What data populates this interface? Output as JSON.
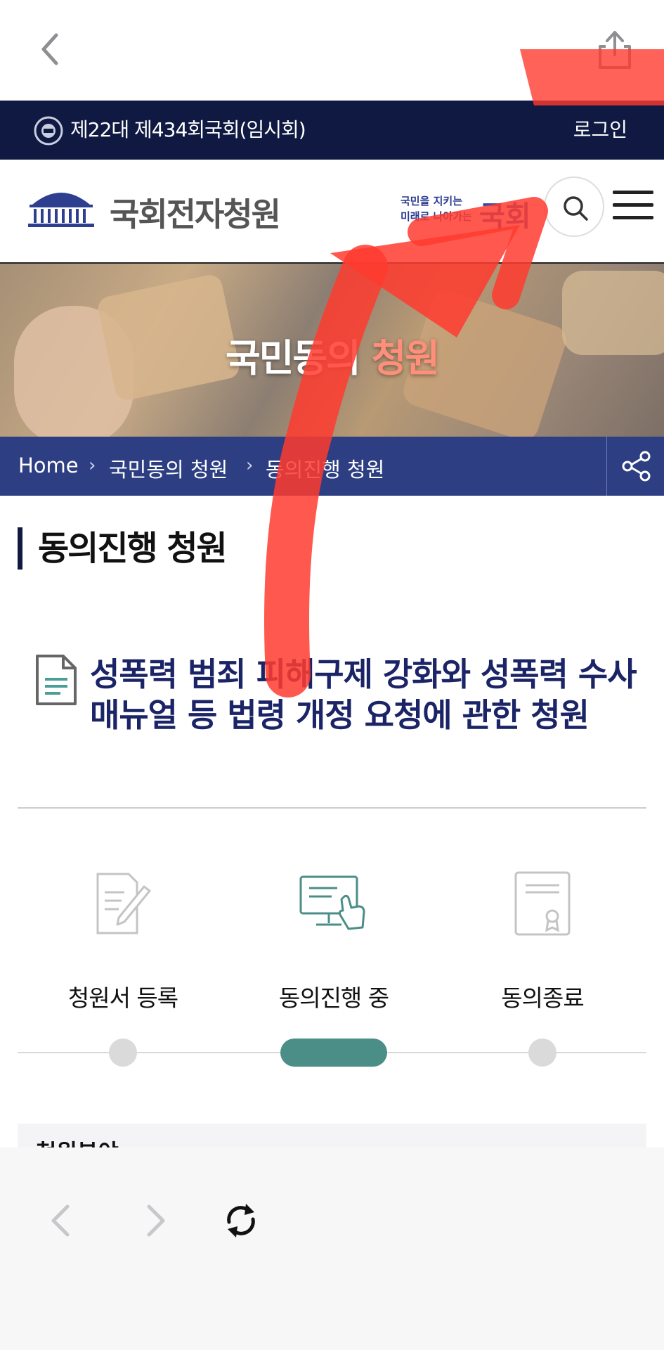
{
  "browser": {
    "back_icon": "chevron-left-icon",
    "share_icon": "share-icon"
  },
  "session_bar": {
    "session_text": "제22대 제434회국회(임시회)",
    "login_label": "로그인"
  },
  "header": {
    "site_name": "국회전자청원",
    "slogan_line1": "국민을 지키는",
    "slogan_line2": "미래로 나아가는",
    "slogan_big": "국회"
  },
  "banner": {
    "title_main": "국민동의 ",
    "title_accent": "청원"
  },
  "breadcrumb": {
    "items": [
      "Home",
      "국민동의 청원",
      "동의진행 청원"
    ]
  },
  "page": {
    "heading": "동의진행 청원",
    "petition_title": "성폭력 범죄 피해구제 강화와 성폭력 수사 매뉴얼 등 법령 개정 요청에 관한 청원"
  },
  "steps": [
    {
      "label": "청원서 등록"
    },
    {
      "label": "동의진행 중"
    },
    {
      "label": "동의종료"
    }
  ],
  "section": {
    "label": "청원분야"
  },
  "colors": {
    "navy": "#0f1941",
    "breadcrumb": "#2d3f82",
    "accent_red": "#ff8f7a",
    "step_active": "#4b8e88",
    "annotation": "#ff3b2f"
  }
}
